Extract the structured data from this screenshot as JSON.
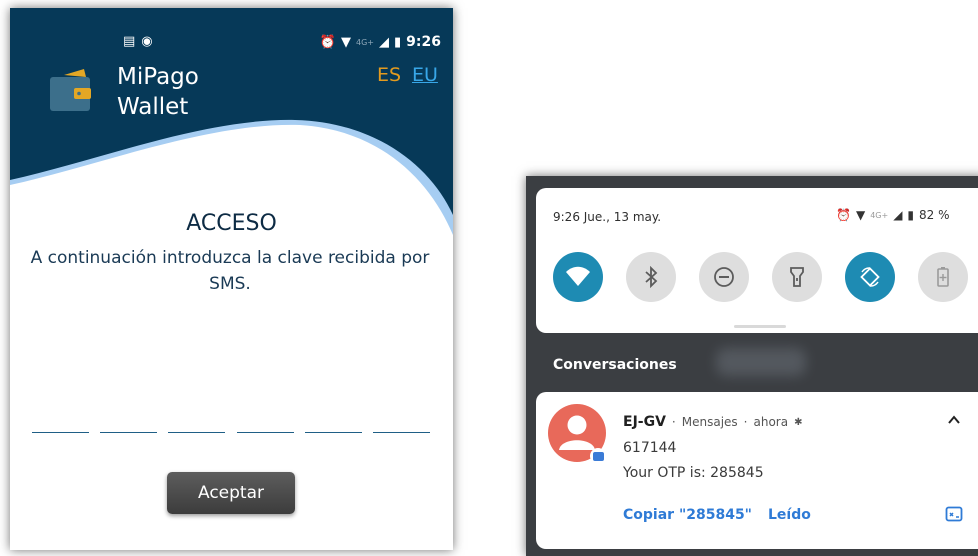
{
  "left_phone": {
    "status_bar": {
      "left_icons": [
        "notification-icon",
        "app-icon"
      ],
      "network": "4G+",
      "time": "9:26"
    },
    "app": {
      "name_line1": "MiPago",
      "name_line2": "Wallet",
      "lang_es": "ES",
      "lang_eu": "EU"
    },
    "title": "ACCESO",
    "instructions": "A continuación introduzca la clave recibida por SMS.",
    "otp_slot_count": 6,
    "accept_button": "Aceptar",
    "colors": {
      "header": "#063958",
      "lang_es": "#e39b1f",
      "lang_eu": "#38a7e8"
    }
  },
  "right_phone": {
    "quick_settings": {
      "datetime": "9:26 Jue., 13 may.",
      "network": "4G+",
      "battery": "82 %",
      "tiles": [
        {
          "name": "wifi-icon",
          "active": true
        },
        {
          "name": "bluetooth-icon",
          "active": false
        },
        {
          "name": "do-not-disturb-icon",
          "active": false
        },
        {
          "name": "flashlight-icon",
          "active": false
        },
        {
          "name": "auto-rotate-icon",
          "active": true
        },
        {
          "name": "battery-saver-icon",
          "active": false
        }
      ]
    },
    "section_label": "Conversaciones",
    "notification": {
      "sender": "EJ-GV",
      "app": "Mensajes",
      "time": "ahora",
      "line1": "617144",
      "line2": "Your OTP is: 285845",
      "action_copy": "Copiar \"285845\"",
      "action_read": "Leído"
    }
  }
}
